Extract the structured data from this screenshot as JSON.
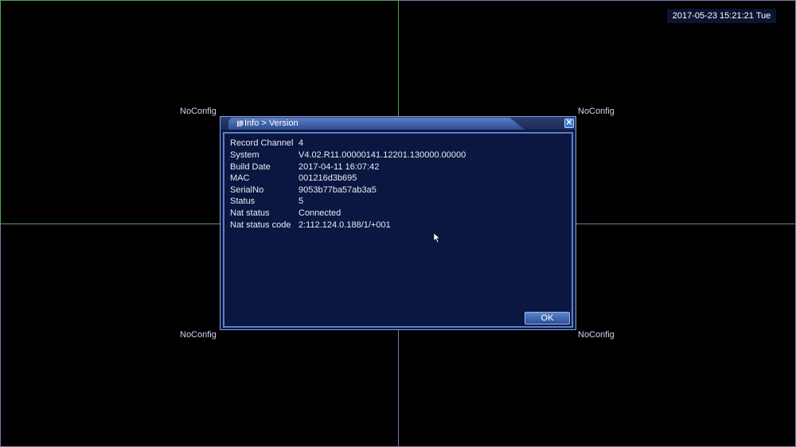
{
  "datetime": "2017-05-23 15:21:21 Tue",
  "channels": [
    {
      "label": "NoConfig"
    },
    {
      "label": "NoConfig"
    },
    {
      "label": "NoConfig"
    },
    {
      "label": "NoConfig"
    }
  ],
  "dialog": {
    "title": "Info > Version",
    "close_icon": "close-icon",
    "ok_label": "OK",
    "rows": [
      {
        "label": "Record Channel",
        "value": "4"
      },
      {
        "label": "System",
        "value": "V4.02.R11.00000141.12201.130000.00000"
      },
      {
        "label": "Build Date",
        "value": "2017-04-11 16:07:42"
      },
      {
        "label": "MAC",
        "value": "001216d3b695"
      },
      {
        "label": "SerialNo",
        "value": "9053b77ba57ab3a5"
      },
      {
        "label": "Status",
        "value": "5"
      },
      {
        "label": "Nat status",
        "value": "Connected"
      },
      {
        "label": "Nat status code",
        "value": "2:112.124.0.188/1/+001"
      }
    ]
  },
  "colors": {
    "background": "#000000",
    "dialog_bg": "#0e1a45",
    "dialog_border": "#7fa2dc",
    "accent": "#5a86cf",
    "grid_green": "#5aa05a",
    "grid_purple": "#7a7aa8"
  }
}
